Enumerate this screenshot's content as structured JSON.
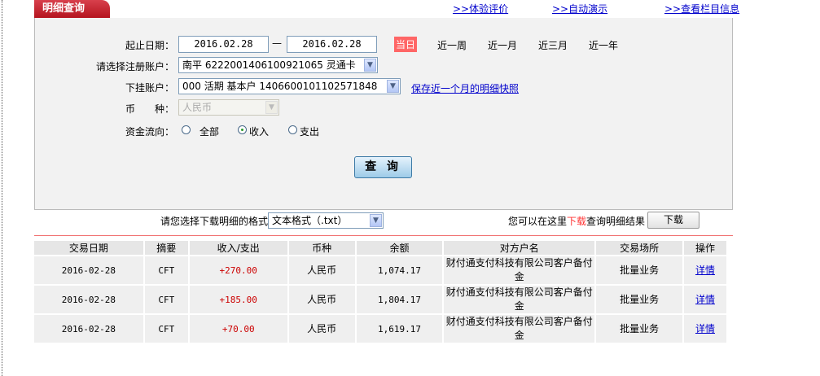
{
  "tab_title": "明细查询",
  "top_links": [
    ">>体验评价",
    ">>自动演示",
    ">>查看栏目信息"
  ],
  "form": {
    "date_label": "起止日期：",
    "date_from": "2016.02.28",
    "date_sep": "—",
    "date_to": "2016.02.28",
    "periods": [
      "当日",
      "近一周",
      "近一月",
      "近三月",
      "近一年"
    ],
    "active_period": "当日",
    "account_label": "请选择注册账户：",
    "account_value": "南平 6222001406100921065 灵通卡",
    "sub_account_label": "下挂账户：",
    "sub_account_value": "000 活期 基本户 1406600101102571848",
    "snapshot_link": "保存近一个月的明细快照",
    "currency_label": "币　　种：",
    "currency_value": "人民币",
    "flow_label": "资金流向：",
    "flow_options": [
      "全部",
      "收入",
      "支出"
    ],
    "flow_selected": "收入",
    "query_button": "查 询"
  },
  "download": {
    "format_label": "请您选择下载明细的格式",
    "format_value": "文本格式（.txt）",
    "hint_pre": "您可以在这里",
    "hint_red": "下载",
    "hint_post": "查询明细结果",
    "button": "下载"
  },
  "colors": {
    "accent": "#c0202c",
    "amount": "#cc0000",
    "link": "#0000cc"
  },
  "table": {
    "headers": [
      "交易日期",
      "摘要",
      "收入/支出",
      "币种",
      "余额",
      "对方户名",
      "交易场所",
      "操作"
    ],
    "rows": [
      [
        "2016-02-28",
        "CFT",
        "+270.00",
        "人民币",
        "1,074.17",
        "财付通支付科技有限公司客户备付金",
        "批量业务",
        "详情"
      ],
      [
        "2016-02-28",
        "CFT",
        "+185.00",
        "人民币",
        "1,804.17",
        "财付通支付科技有限公司客户备付金",
        "批量业务",
        "详情"
      ],
      [
        "2016-02-28",
        "CFT",
        "+70.00",
        "人民币",
        "1,619.17",
        "财付通支付科技有限公司客户备付金",
        "批量业务",
        "详情"
      ]
    ]
  }
}
